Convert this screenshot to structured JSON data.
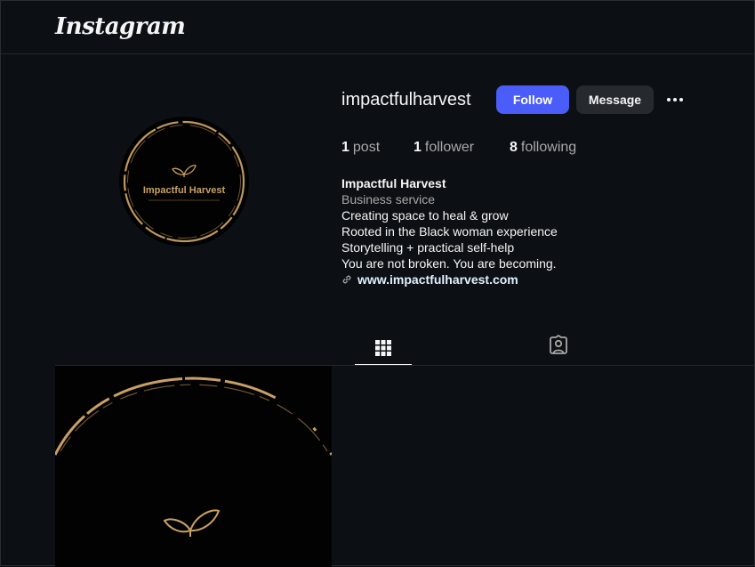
{
  "header": {
    "logo_text": "Instagram"
  },
  "profile": {
    "username": "impactfulharvest",
    "avatar_text": "Impactful Harvest",
    "follow_label": "Follow",
    "message_label": "Message",
    "stats": {
      "posts_count": "1",
      "posts_label": "post",
      "followers_count": "1",
      "followers_label": "follower",
      "following_count": "8",
      "following_label": "following"
    },
    "bio": {
      "display_name": "Impactful Harvest",
      "category": "Business service",
      "lines": [
        "Creating space to heal & grow",
        "Rooted in the Black woman experience",
        "Storytelling + practical self-help",
        "You are not broken. You are becoming."
      ],
      "website": "www.impactfulharvest.com"
    }
  },
  "tabs": [
    {
      "icon": "grid-icon",
      "active": true
    },
    {
      "icon": "tagged-icon",
      "active": false
    }
  ],
  "posts": [
    {
      "icon": "leaf-logo-icon"
    }
  ],
  "colors": {
    "background": "#0c1014",
    "follow_button": "#4a5df9",
    "message_button": "#262a2e",
    "gold_accent": "#c9a063",
    "secondary_text": "#a8a8a8"
  }
}
